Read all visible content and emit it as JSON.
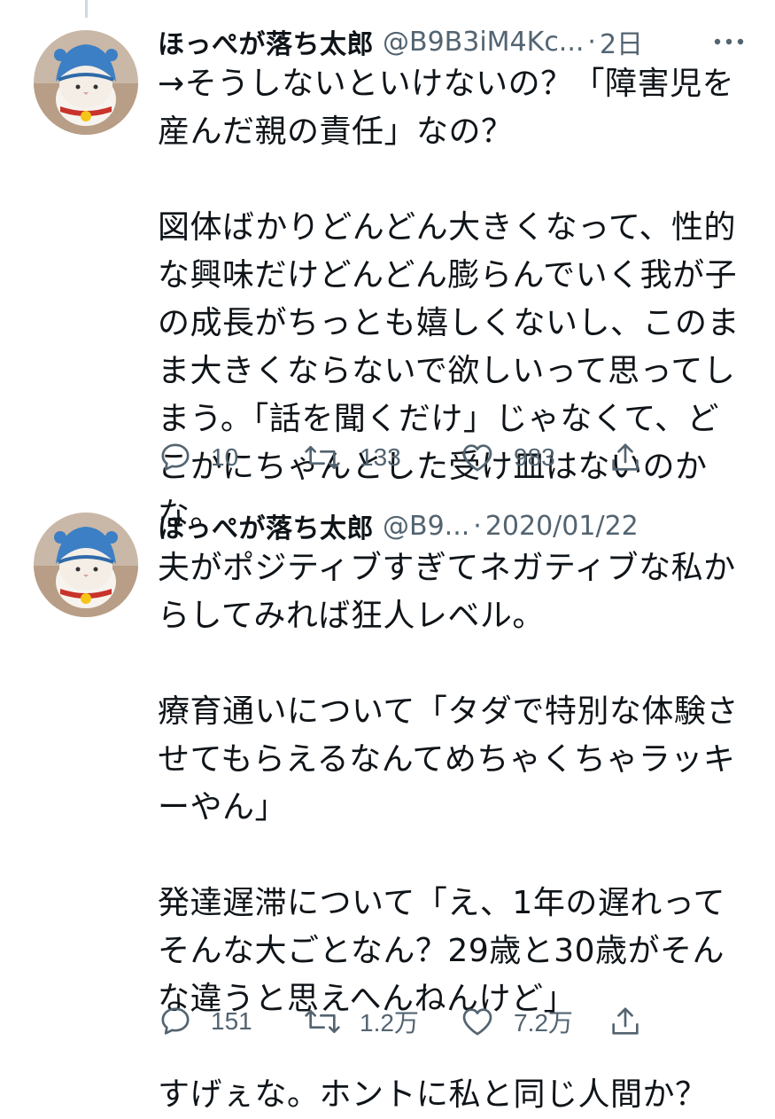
{
  "tweets": [
    {
      "display_name": "ほっぺが落ち太郎",
      "handle": "@B9B3iM4Kc...",
      "separator": "·",
      "time": "2日",
      "text": "→そうしないといけないの？「障害児を産んだ親の責任」なの？\n\n図体ばかりどんどん大きくなって、性的な興味だけどんどん膨らんでいく我が子の成長がちっとも嬉しくないし、このまま大きくならないで欲しいって思ってしまう。「話を聞くだけ」じゃなくて、どこかにちゃんとした受け皿はないのかな。",
      "reply_count": "10",
      "retweet_count": "133",
      "like_count": "983"
    },
    {
      "display_name": "ほっぺが落ち太郎",
      "handle": "@B9...",
      "separator": "·",
      "time": "2020/01/22",
      "text": "夫がポジティブすぎてネガティブな私からしてみれば狂人レベル。\n\n療育通いについて「タダで特別な体験させてもらえるなんてめちゃくちゃラッキーやん」\n\n発達遅滞について「え、1年の遅れってそんな大ごとなん？29歳と30歳がそんな違うと思えへんねんけど」\n\nすげぇな。ホントに私と同じ人間か？",
      "reply_count": "151",
      "retweet_count": "1.2万",
      "like_count": "7.2万"
    }
  ],
  "icons": {
    "reply": "speech-bubble-icon",
    "retweet": "retweet-arrows-icon",
    "like": "heart-outline-icon",
    "share": "share-upload-icon",
    "more": "more-dots-icon"
  },
  "colors": {
    "text": "#0f1419",
    "secondary": "#536471",
    "thread_line": "#cfd9de",
    "background": "#ffffff"
  }
}
